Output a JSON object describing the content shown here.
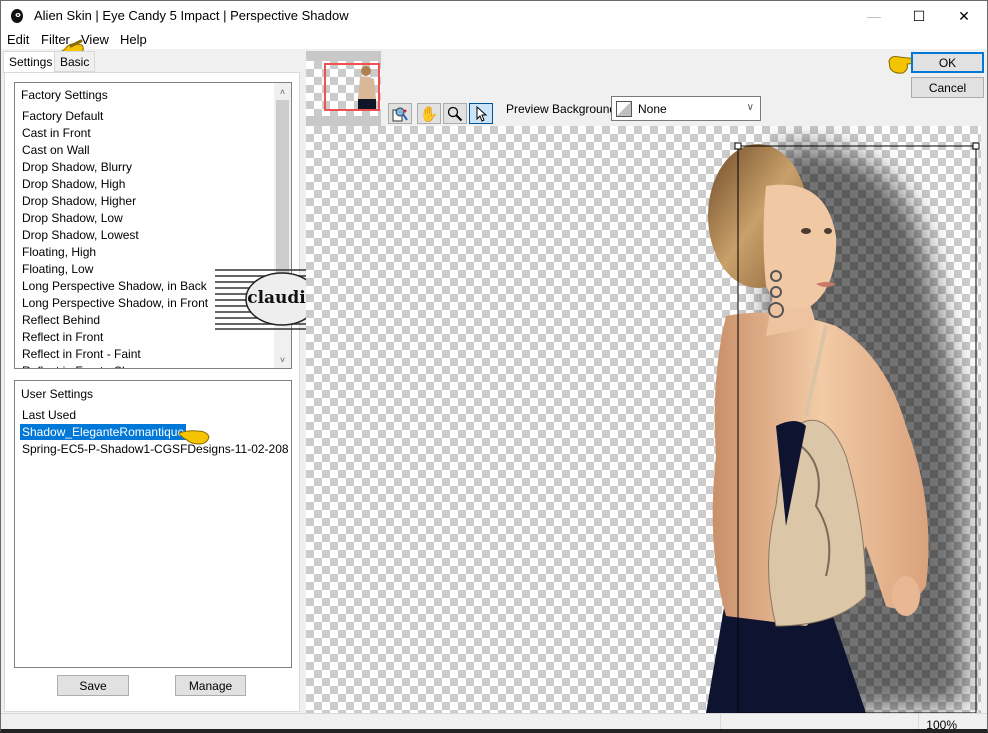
{
  "window": {
    "title": "Alien Skin | Eye Candy 5 Impact | Perspective Shadow",
    "controls": {
      "minimize": "—",
      "maximize": "☐",
      "close": "✕"
    }
  },
  "menu": [
    "Edit",
    "Filter",
    "View",
    "Help"
  ],
  "tabs": [
    {
      "label": "Settings",
      "active": true
    },
    {
      "label": "Basic",
      "active": false
    }
  ],
  "factory_settings": {
    "header": "Factory Settings",
    "items": [
      "Factory Default",
      "Cast in Front",
      "Cast on Wall",
      "Drop Shadow, Blurry",
      "Drop Shadow, High",
      "Drop Shadow, Higher",
      "Drop Shadow, Low",
      "Drop Shadow, Lowest",
      "Floating, High",
      "Floating, Low",
      "Long Perspective Shadow, in Back",
      "Long Perspective Shadow, in Front",
      "Reflect Behind",
      "Reflect in Front",
      "Reflect in Front - Faint",
      "Reflect in Front - Sharp"
    ]
  },
  "user_settings": {
    "header": "User Settings",
    "items": [
      {
        "label": "Last Used",
        "selected": false
      },
      {
        "label": "Shadow_EleganteRomantique",
        "selected": true
      },
      {
        "label": "Spring-EC5-P-Shadow1-CGSFDesigns-11-02-208",
        "selected": false
      }
    ]
  },
  "buttons": {
    "save": "Save",
    "manage": "Manage",
    "ok": "OK",
    "cancel": "Cancel"
  },
  "toolbar": {
    "tools": [
      "preview-compare-icon",
      "hand-icon",
      "zoom-icon",
      "pointer-icon"
    ],
    "active_tool": "pointer-icon",
    "preview_background_label": "Preview Background:",
    "preview_background_value": "None"
  },
  "watermark": {
    "text": "claudia"
  },
  "status": {
    "zoom": "100%"
  },
  "colors": {
    "selection": "#0078d7",
    "thumbnail_frame": "#f05050",
    "annotation_hand": "#f5c400"
  }
}
